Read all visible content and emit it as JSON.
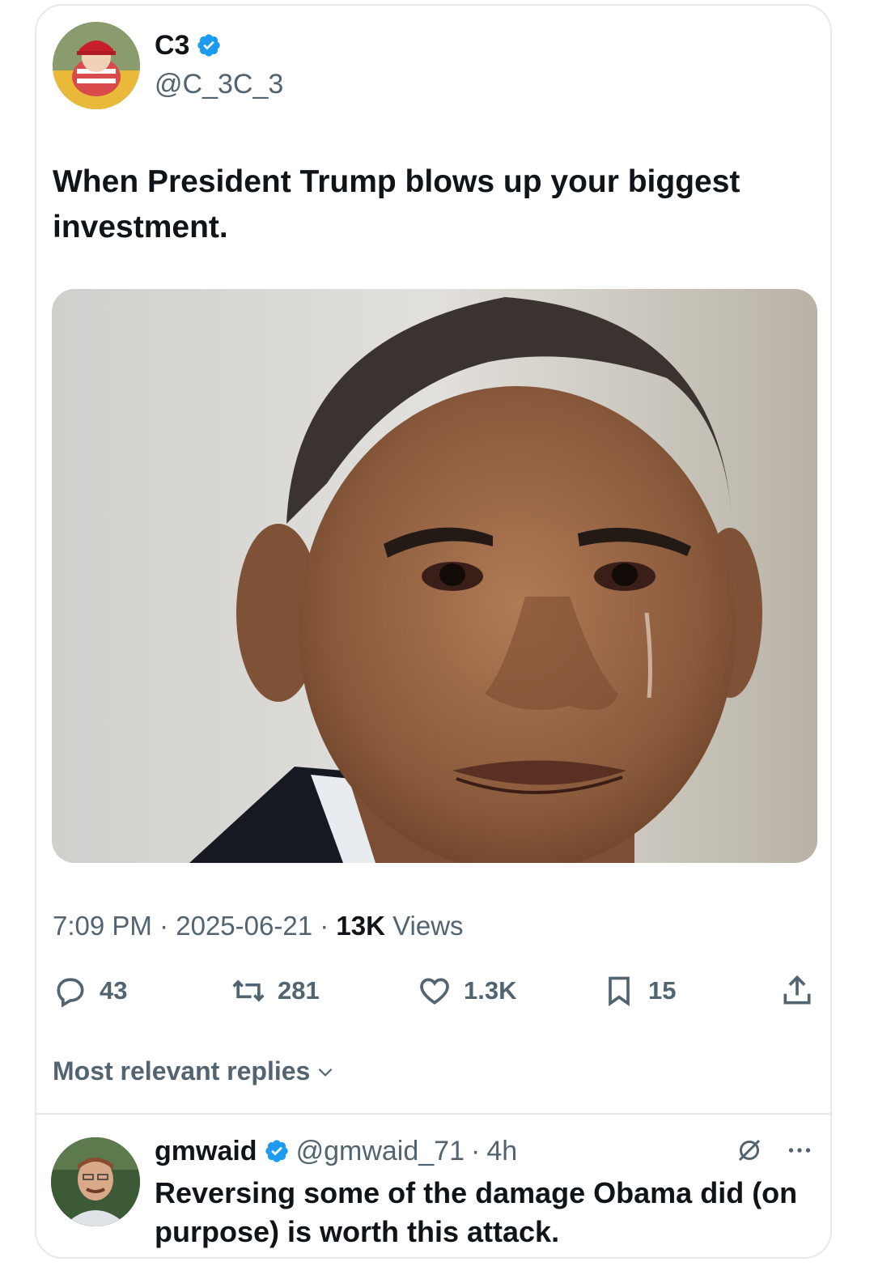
{
  "author": {
    "name": "C3",
    "handle": "@C_3C_3",
    "verified": true
  },
  "tweet": {
    "text": "When President Trump blows up your biggest investment.",
    "media_description_icon": "photo",
    "time": "7:09 PM",
    "date": "2025-06-21",
    "views_count": "13K",
    "views_label": "Views",
    "separator": "·"
  },
  "actions": {
    "replies": "43",
    "reposts": "281",
    "likes": "1.3K",
    "bookmarks": "15"
  },
  "replies_section": {
    "label": "Most relevant replies"
  },
  "reply": {
    "name": "gmwaid",
    "handle": "@gmwaid_71",
    "age": "4h",
    "separator": "·",
    "text": "Reversing some of the damage Obama did (on purpose) is worth this attack."
  },
  "colors": {
    "verified_blue": "#1d9bf0",
    "text_primary": "#0f1419",
    "text_secondary": "#536471",
    "border": "#e6e9eb"
  }
}
